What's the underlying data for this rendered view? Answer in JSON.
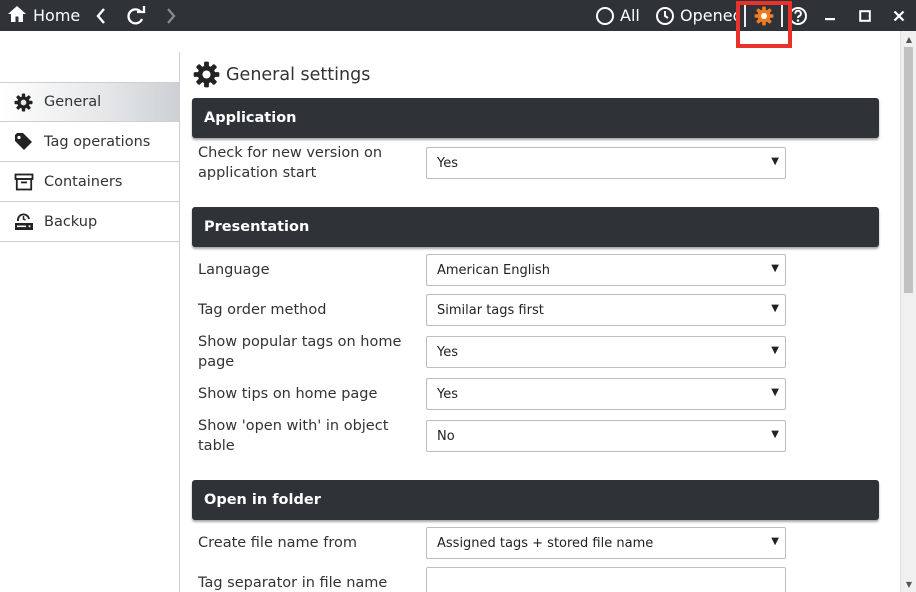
{
  "titlebar": {
    "home_label": "Home",
    "all_label": "All",
    "opened_label": "Opened"
  },
  "sidebar": {
    "items": [
      {
        "label": "General",
        "icon": "gear-icon",
        "active": true
      },
      {
        "label": "Tag operations",
        "icon": "tag-icon",
        "active": false
      },
      {
        "label": "Containers",
        "icon": "archive-box-icon",
        "active": false
      },
      {
        "label": "Backup",
        "icon": "backup-icon",
        "active": false
      }
    ]
  },
  "main": {
    "title": "General settings",
    "sections": {
      "application": {
        "header": "Application",
        "check_version": {
          "label": "Check for new version on application start",
          "value": "Yes"
        }
      },
      "presentation": {
        "header": "Presentation",
        "language": {
          "label": "Language",
          "value": "American English"
        },
        "tag_order": {
          "label": "Tag order method",
          "value": "Similar tags first"
        },
        "popular_tags": {
          "label": "Show popular tags on home page",
          "value": "Yes"
        },
        "tips": {
          "label": "Show tips on home page",
          "value": "Yes"
        },
        "open_with": {
          "label": "Show 'open with' in object table",
          "value": "No"
        }
      },
      "open_in_folder": {
        "header": "Open in folder",
        "file_name_from": {
          "label": "Create file name from",
          "value": "Assigned tags + stored file name"
        },
        "tag_separator": {
          "label": "Tag separator in file name",
          "value": "_"
        }
      }
    }
  },
  "colors": {
    "titlebar_bg": "#2f3237",
    "section_header_bg": "#2f3237",
    "highlight_border": "#e8322b",
    "active_gear": "#f07b20"
  }
}
